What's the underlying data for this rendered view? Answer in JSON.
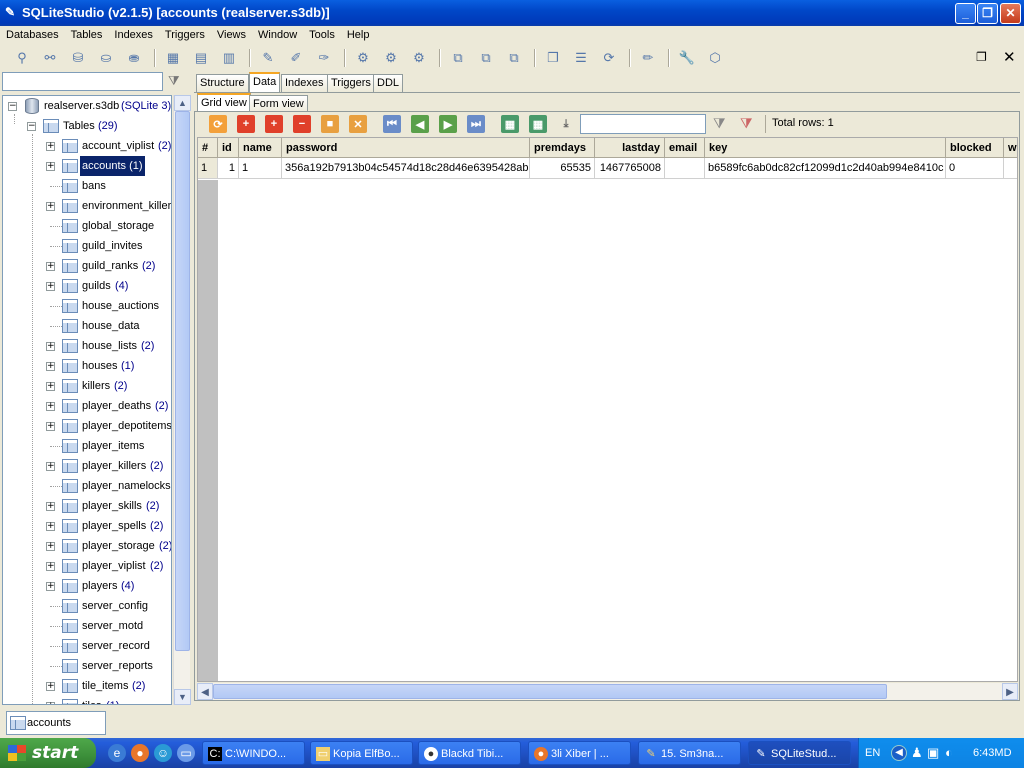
{
  "window": {
    "title": "SQLiteStudio (v2.1.5) [accounts (realserver.s3db)]"
  },
  "menu": [
    "Databases",
    "Tables",
    "Indexes",
    "Triggers",
    "Views",
    "Window",
    "Tools",
    "Help"
  ],
  "tree": {
    "database": {
      "name": "realserver.s3db",
      "type": "(SQLite 3)"
    },
    "tables_node": {
      "name": "Tables",
      "count": "(29)"
    },
    "items": [
      {
        "name": "account_viplist",
        "count": "(2)",
        "exp": true
      },
      {
        "name": "accounts",
        "count": "(1)",
        "exp": true,
        "selected": true
      },
      {
        "name": "bans",
        "count": "",
        "exp": false
      },
      {
        "name": "environment_killers",
        "count": "",
        "exp": true
      },
      {
        "name": "global_storage",
        "count": "",
        "exp": false
      },
      {
        "name": "guild_invites",
        "count": "",
        "exp": false
      },
      {
        "name": "guild_ranks",
        "count": "(2)",
        "exp": true
      },
      {
        "name": "guilds",
        "count": "(4)",
        "exp": true
      },
      {
        "name": "house_auctions",
        "count": "",
        "exp": false
      },
      {
        "name": "house_data",
        "count": "",
        "exp": false
      },
      {
        "name": "house_lists",
        "count": "(2)",
        "exp": true
      },
      {
        "name": "houses",
        "count": "(1)",
        "exp": true
      },
      {
        "name": "killers",
        "count": "(2)",
        "exp": true
      },
      {
        "name": "player_deaths",
        "count": "(2)",
        "exp": true
      },
      {
        "name": "player_depotitems",
        "count": "",
        "exp": true
      },
      {
        "name": "player_items",
        "count": "",
        "exp": false
      },
      {
        "name": "player_killers",
        "count": "(2)",
        "exp": true
      },
      {
        "name": "player_namelocks",
        "count": "",
        "exp": false
      },
      {
        "name": "player_skills",
        "count": "(2)",
        "exp": true
      },
      {
        "name": "player_spells",
        "count": "(2)",
        "exp": true
      },
      {
        "name": "player_storage",
        "count": "(2)",
        "exp": true
      },
      {
        "name": "player_viplist",
        "count": "(2)",
        "exp": true
      },
      {
        "name": "players",
        "count": "(4)",
        "exp": true
      },
      {
        "name": "server_config",
        "count": "",
        "exp": false
      },
      {
        "name": "server_motd",
        "count": "",
        "exp": false
      },
      {
        "name": "server_record",
        "count": "",
        "exp": false
      },
      {
        "name": "server_reports",
        "count": "",
        "exp": false
      },
      {
        "name": "tile_items",
        "count": "(2)",
        "exp": true
      },
      {
        "name": "tiles",
        "count": "(1)",
        "exp": true
      }
    ]
  },
  "tabs": [
    "Structure",
    "Data",
    "Indexes",
    "Triggers",
    "DDL"
  ],
  "subtabs": [
    "Grid view",
    "Form view"
  ],
  "grid": {
    "total_rows": "Total rows: 1",
    "filter_value": "",
    "columns": [
      "#",
      "id",
      "name",
      "password",
      "premdays",
      "lastday",
      "email",
      "key",
      "blocked",
      "w"
    ],
    "rows": [
      [
        "1",
        "1",
        "1",
        "356a192b7913b04c54574d18c28d46e6395428ab",
        "65535",
        "1467765008",
        "",
        "b6589fc6ab0dc82cf12099d1c2d40ab994e8410c",
        "0",
        ""
      ]
    ]
  },
  "windowbar": {
    "tab": "accounts (realse"
  },
  "taskbar": {
    "start": "start",
    "tasks": [
      "C:\\WINDO...",
      "Kopia ElfBo...",
      "Blackd Tibi...",
      "3li Xiber | ...",
      "15. Sm3na...",
      "SQLiteStud..."
    ],
    "lang": "EN",
    "clock": "6:43MD"
  }
}
